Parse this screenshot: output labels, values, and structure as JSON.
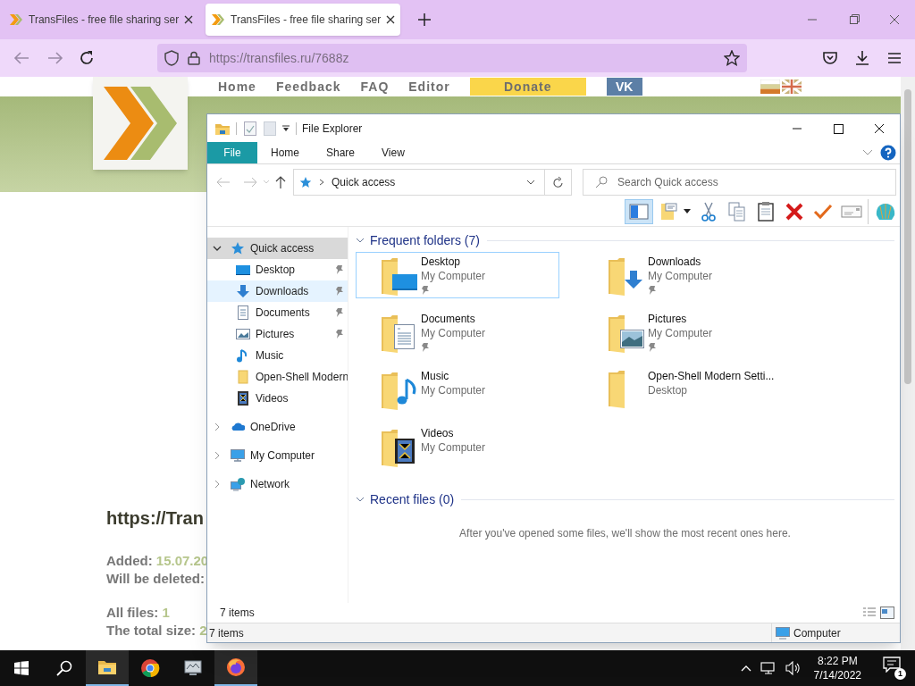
{
  "browser": {
    "tabs": [
      {
        "title": "TransFiles - free file sharing ser",
        "selected": false
      },
      {
        "title": "TransFiles - free file sharing ser",
        "selected": true
      }
    ],
    "url_host": "https://transfiles.ru",
    "url_path": "/7688z"
  },
  "webpage": {
    "nav": [
      {
        "label": "Home",
        "kind": "link"
      },
      {
        "label": "Feedback",
        "kind": "link"
      },
      {
        "label": "FAQ",
        "kind": "link"
      },
      {
        "label": "Editor",
        "kind": "link"
      },
      {
        "label": "Donate",
        "kind": "donate"
      },
      {
        "label": "VK",
        "kind": "vk"
      }
    ],
    "heading": "https://Tran",
    "info": [
      {
        "label": "Added:",
        "value": "15.07.20"
      },
      {
        "label": "Will be deleted:"
      },
      {
        "label": "All files:",
        "value": "1"
      },
      {
        "label": "The total size:",
        "value": "2"
      }
    ]
  },
  "explorer": {
    "title": "File Explorer",
    "ribbon_tabs": [
      {
        "label": "File",
        "selected": true
      },
      {
        "label": "Home",
        "selected": false
      },
      {
        "label": "Share",
        "selected": false
      },
      {
        "label": "View",
        "selected": false
      }
    ],
    "address": "Quick access",
    "search": {
      "placeholder": "Search Quick access"
    },
    "toolbar": [
      {
        "kind": "pane",
        "pressed": true
      },
      {
        "kind": "new-folder",
        "pressed": false
      },
      {
        "kind": "cut",
        "pressed": false
      },
      {
        "kind": "copy",
        "pressed": false
      },
      {
        "kind": "paste",
        "pressed": false
      },
      {
        "kind": "delete",
        "pressed": false
      },
      {
        "kind": "check",
        "pressed": false
      },
      {
        "kind": "mail",
        "pressed": false
      },
      {
        "kind": "shell",
        "pressed": false
      }
    ],
    "nav_tree": [
      {
        "label": "Quick access",
        "kind": "star",
        "expanded": true,
        "selected": true,
        "children": [
          {
            "label": "Desktop",
            "kind": "desktop",
            "pinned": true,
            "selected": false,
            "hovered": false
          },
          {
            "label": "Downloads",
            "kind": "downloads",
            "pinned": true,
            "selected": false,
            "hovered": true
          },
          {
            "label": "Documents",
            "kind": "documents",
            "pinned": true,
            "selected": false,
            "hovered": false
          },
          {
            "label": "Pictures",
            "kind": "pictures",
            "pinned": true,
            "selected": false,
            "hovered": false
          },
          {
            "label": "Music",
            "kind": "music",
            "pinned": false,
            "selected": false,
            "hovered": false
          },
          {
            "label": "Open-Shell Modern",
            "kind": "folder",
            "pinned": false,
            "selected": false,
            "hovered": false
          },
          {
            "label": "Videos",
            "kind": "videos",
            "pinned": false,
            "selected": false,
            "hovered": false
          }
        ]
      },
      {
        "label": "OneDrive",
        "kind": "cloud",
        "expanded": false,
        "selected": false
      },
      {
        "label": "My Computer",
        "kind": "computer",
        "expanded": false,
        "selected": false
      },
      {
        "label": "Network",
        "kind": "network",
        "expanded": false,
        "selected": false
      }
    ],
    "sections": [
      {
        "title": "Frequent folders (7)",
        "expanded": true,
        "items": [
          {
            "name": "Desktop",
            "location": "My Computer",
            "kind": "desktop",
            "pinned": true,
            "selected": true
          },
          {
            "name": "Downloads",
            "location": "My Computer",
            "kind": "downloads",
            "pinned": true,
            "selected": false
          },
          {
            "name": "Documents",
            "location": "My Computer",
            "kind": "documents",
            "pinned": true,
            "selected": false
          },
          {
            "name": "Pictures",
            "location": "My Computer",
            "kind": "pictures",
            "pinned": true,
            "selected": false
          },
          {
            "name": "Music",
            "location": "My Computer",
            "kind": "music",
            "pinned": false,
            "selected": false
          },
          {
            "name": "Open-Shell Modern Setti...",
            "location": "Desktop",
            "kind": "folder",
            "pinned": false,
            "selected": false
          },
          {
            "name": "Videos",
            "location": "My Computer",
            "kind": "videos",
            "pinned": false,
            "selected": false
          }
        ]
      },
      {
        "title": "Recent files (0)",
        "expanded": true,
        "message": "After you've opened some files, we'll show the most recent ones here."
      }
    ],
    "item_count": "7 items",
    "status_left": "7 items",
    "status_right": "Computer"
  },
  "taskbar": {
    "apps": [
      {
        "kind": "explorer",
        "active": true
      },
      {
        "kind": "chrome",
        "active": false
      },
      {
        "kind": "monitor",
        "active": false
      },
      {
        "kind": "firefox",
        "active": true
      }
    ],
    "time": "8:22 PM",
    "date": "7/14/2022",
    "notifications": "1"
  }
}
